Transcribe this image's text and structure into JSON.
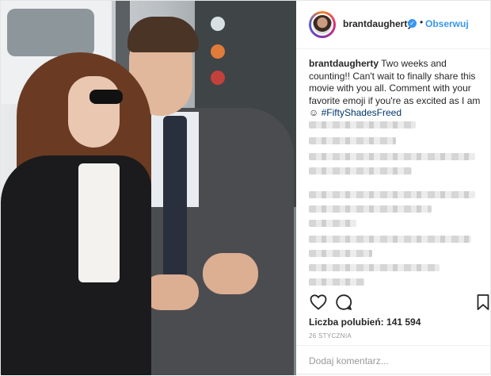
{
  "header": {
    "username": "brantdaugherty",
    "separator": "•",
    "follow_label": "Obserwuj",
    "verified_mark": "✓"
  },
  "caption": {
    "username": "brantdaugherty",
    "text": "Two weeks and counting!! Can't wait to finally share this movie with you all. Comment with your favorite emoji if you're as excited as I am ☺",
    "hashtag": "#FiftyShadesFreed"
  },
  "actions": {
    "like_icon": "heart-icon",
    "comment_icon": "comment-icon",
    "save_icon": "bookmark-icon"
  },
  "likes": {
    "label": "Liczba polubień:",
    "count": "141 594"
  },
  "date": "26 STYCZNIA",
  "comment_box": {
    "placeholder": "Dodaj komentarz..."
  },
  "colors": {
    "link_blue": "#3897f0",
    "hashtag": "#003569",
    "text": "#262626"
  }
}
